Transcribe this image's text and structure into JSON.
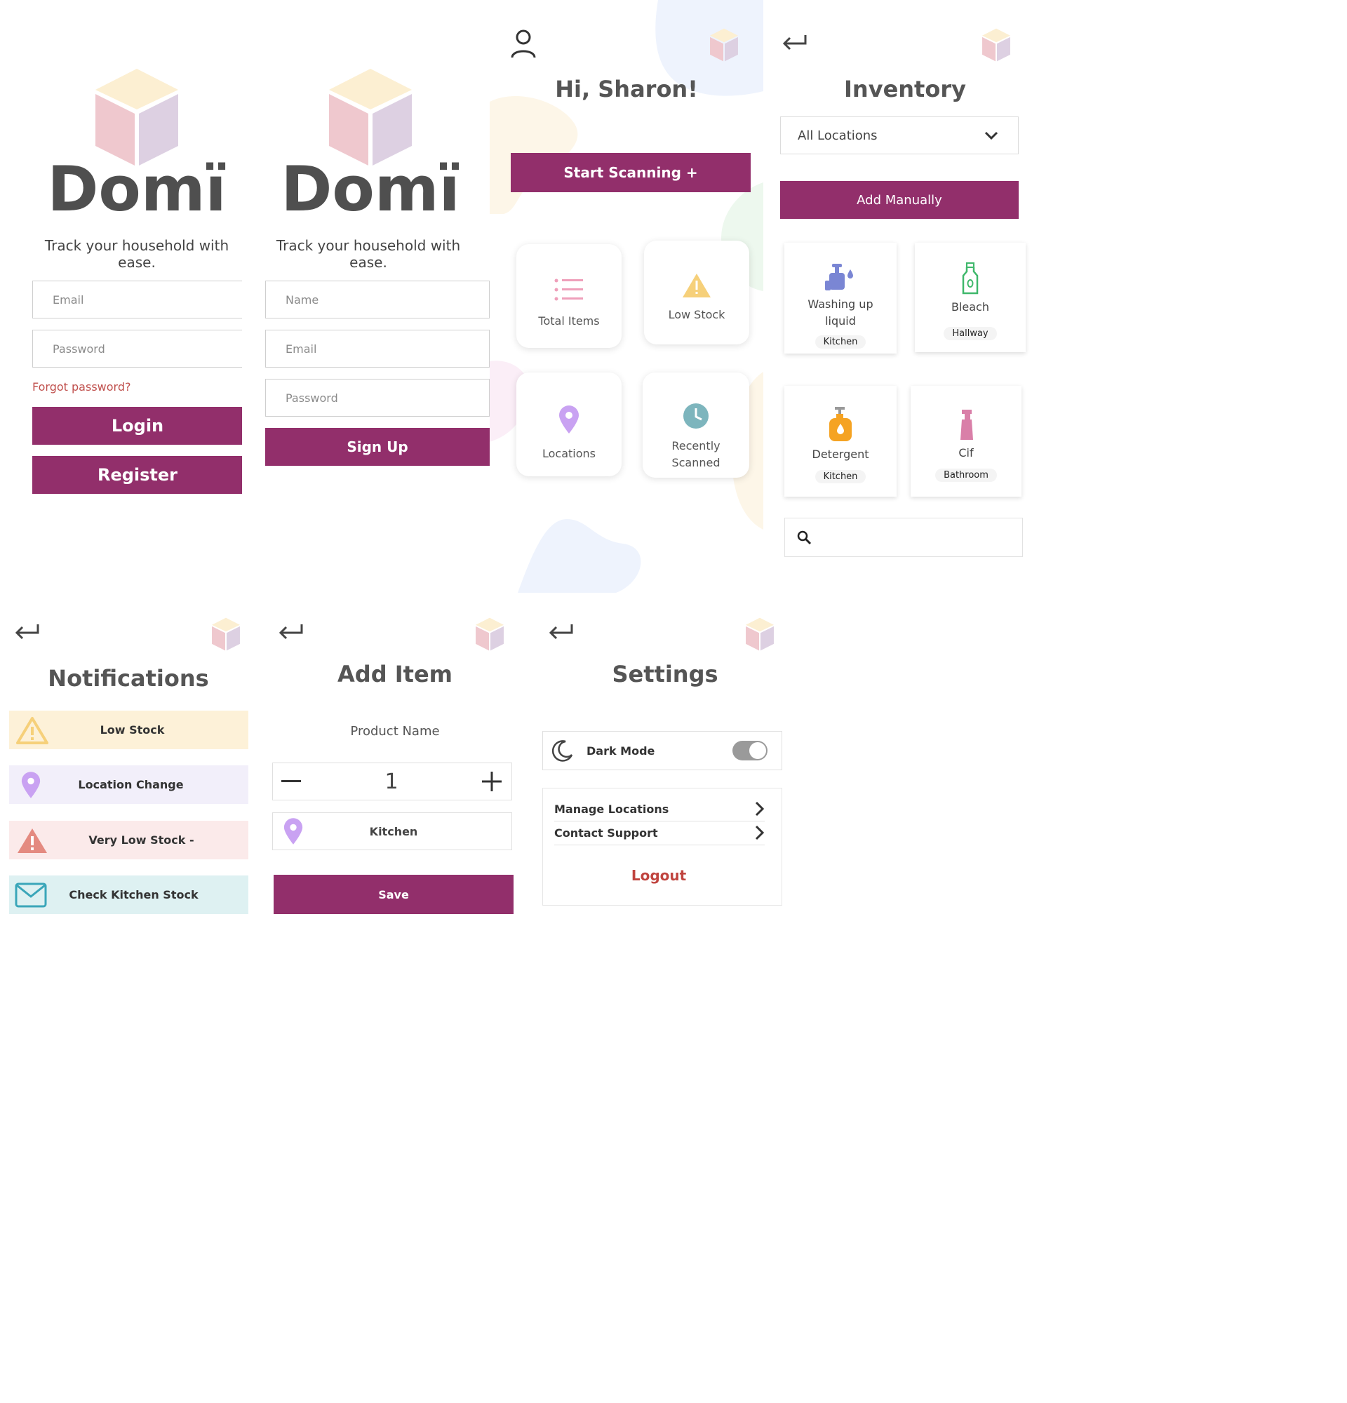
{
  "brand": {
    "logo_text": "Domï",
    "tagline": "Track your household with ease."
  },
  "login": {
    "email_placeholder": "Email",
    "password_placeholder": "Password",
    "forgot": "Forgot password?",
    "login_label": "Login",
    "register_label": "Register"
  },
  "signup": {
    "name_placeholder": "Name",
    "email_placeholder": "Email",
    "password_placeholder": "Password",
    "signup_label": "Sign Up"
  },
  "home": {
    "greeting": "Hi, Sharon!",
    "scan_label": "Start Scanning +",
    "cards": [
      {
        "label": "Total Items",
        "icon": "list-icon"
      },
      {
        "label": "Low Stock",
        "icon": "warning-icon"
      },
      {
        "label": "Locations",
        "icon": "location-pin-icon"
      },
      {
        "label": "Recently Scanned",
        "icon": "clock-icon"
      }
    ]
  },
  "inventory": {
    "title": "Inventory",
    "location_select": "All Locations",
    "add_manually": "Add Manually",
    "items": [
      {
        "name": "Washing up liquid",
        "location": "Kitchen",
        "icon": "dish-soap-icon"
      },
      {
        "name": "Bleach",
        "location": "Hallway",
        "icon": "bottle-icon"
      },
      {
        "name": "Detergent",
        "location": "Kitchen",
        "icon": "detergent-icon"
      },
      {
        "name": "Cif",
        "location": "Bathroom",
        "icon": "spray-bottle-icon"
      }
    ]
  },
  "notifications": {
    "title": "Notifications",
    "items": [
      {
        "label": "Low Stock",
        "icon": "warning-icon",
        "bg": "#fdf1d8"
      },
      {
        "label": "Location Change",
        "icon": "location-pin-icon",
        "bg": "#f2effa"
      },
      {
        "label": "Very Low Stock -",
        "icon": "alert-icon",
        "bg": "#fbeaea"
      },
      {
        "label": "Check Kitchen Stock",
        "icon": "mail-icon",
        "bg": "#def1f2"
      }
    ]
  },
  "add_item": {
    "title": "Add Item",
    "product_label": "Product Name",
    "quantity": "1",
    "location": "Kitchen",
    "save_label": "Save"
  },
  "settings": {
    "title": "Settings",
    "dark_mode": "Dark Mode",
    "manage_locations": "Manage Locations",
    "contact_support": "Contact Support",
    "logout": "Logout"
  },
  "colors": {
    "primary": "#922f6b",
    "logout": "#c0443f"
  }
}
